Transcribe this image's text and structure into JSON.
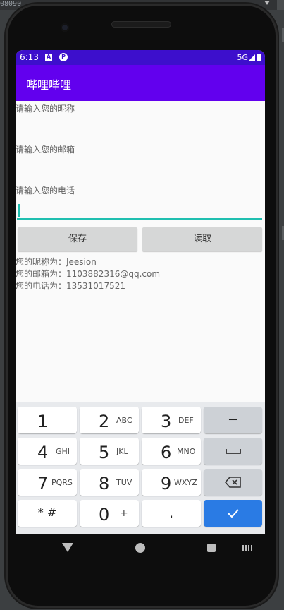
{
  "ide": {
    "corner_text": "08090"
  },
  "status_bar": {
    "time": "6:13",
    "notif_a": "A",
    "notif_p": "P",
    "network": "5G"
  },
  "app_bar": {
    "title": "哔哩哔哩"
  },
  "form": {
    "nickname_label": "请输入您的昵称",
    "email_label": "请输入您的邮箱",
    "phone_label": "请输入您的电话",
    "save_button": "保存",
    "read_button": "读取"
  },
  "results": {
    "nickname": "您的昵称为：Jeesion",
    "email": "您的邮箱为：1103882316@qq.com",
    "phone": "您的电话为：13531017521"
  },
  "keyboard": {
    "keys": [
      {
        "digit": "1",
        "letters": ""
      },
      {
        "digit": "2",
        "letters": "ABC"
      },
      {
        "digit": "3",
        "letters": "DEF"
      },
      {
        "digit": "4",
        "letters": "GHI"
      },
      {
        "digit": "5",
        "letters": "JKL"
      },
      {
        "digit": "6",
        "letters": "MNO"
      },
      {
        "digit": "7",
        "letters": "PQRS"
      },
      {
        "digit": "8",
        "letters": "TUV"
      },
      {
        "digit": "9",
        "letters": "WXYZ"
      },
      {
        "digit": "0",
        "letters": "+"
      }
    ],
    "minus": "−",
    "star_hash": "* #",
    "dot": "."
  }
}
